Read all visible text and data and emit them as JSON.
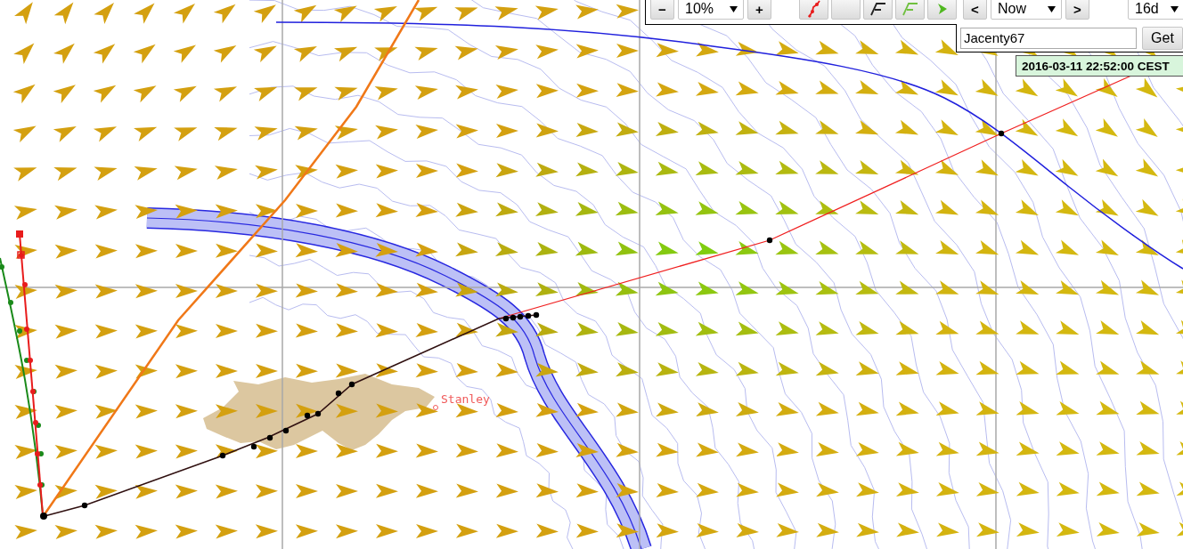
{
  "toolbar": {
    "zoom_out": "−",
    "zoom": "10%",
    "zoom_in": "+",
    "tools": [
      {
        "kind": "route"
      },
      {
        "kind": "blank"
      },
      {
        "kind": "polyline-dark"
      },
      {
        "kind": "polyline-light"
      },
      {
        "kind": "arrow"
      }
    ],
    "time_prev": "<",
    "time": "Now",
    "time_next": ">",
    "range": "16d"
  },
  "boat_search": {
    "value": "Jacenty67",
    "button": "Get"
  },
  "timestamp": "2016-03-11 22:52:00 CEST",
  "map": {
    "place_label": "Stanley"
  }
}
